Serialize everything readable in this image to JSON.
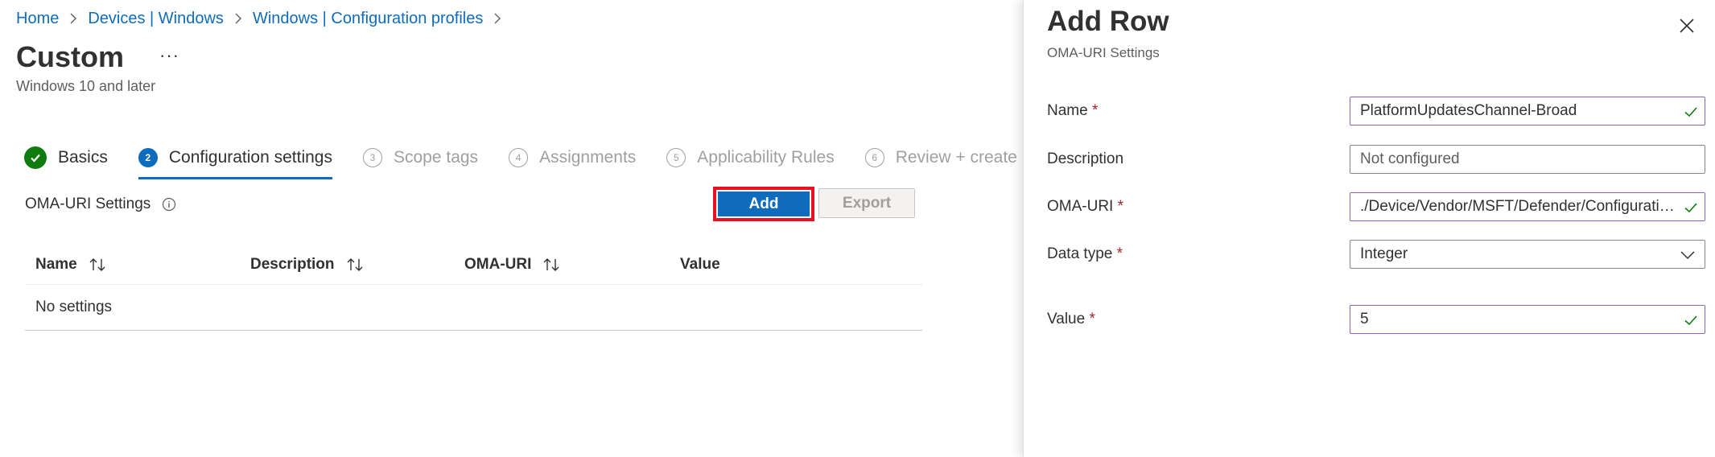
{
  "breadcrumb": [
    "Home",
    "Devices | Windows",
    "Windows | Configuration profiles"
  ],
  "page": {
    "title": "Custom",
    "more": "···",
    "subtitle": "Windows 10 and later"
  },
  "steps": [
    {
      "number": "",
      "label": "Basics",
      "state": "done"
    },
    {
      "number": "2",
      "label": "Configuration settings",
      "state": "active"
    },
    {
      "number": "3",
      "label": "Scope tags",
      "state": "pending"
    },
    {
      "number": "4",
      "label": "Assignments",
      "state": "pending"
    },
    {
      "number": "5",
      "label": "Applicability Rules",
      "state": "pending"
    },
    {
      "number": "6",
      "label": "Review + create",
      "state": "pending"
    }
  ],
  "settings": {
    "section_label": "OMA-URI Settings",
    "add_label": "Add",
    "export_label": "Export"
  },
  "table": {
    "columns": [
      "Name",
      "Description",
      "OMA-URI",
      "Value"
    ],
    "empty_text": "No settings"
  },
  "panel": {
    "title": "Add Row",
    "subtitle": "OMA-URI Settings",
    "fields": {
      "name": {
        "label": "Name",
        "required": "*",
        "value": "PlatformUpdatesChannel-Broad"
      },
      "description": {
        "label": "Description",
        "placeholder": "Not configured"
      },
      "oma_uri": {
        "label": "OMA-URI",
        "required": "*",
        "value": "./Device/Vendor/MSFT/Defender/Configuration/PlatformUpdatesChannel"
      },
      "data_type": {
        "label": "Data type",
        "required": "*",
        "value": "Integer"
      },
      "value": {
        "label": "Value",
        "required": "*",
        "value": "5"
      }
    }
  },
  "colors": {
    "accent": "#0f6cbd",
    "success": "#107c10",
    "required": "#a4262c",
    "highlight_frame": "#e81123",
    "valid_border": "#8764b8"
  }
}
